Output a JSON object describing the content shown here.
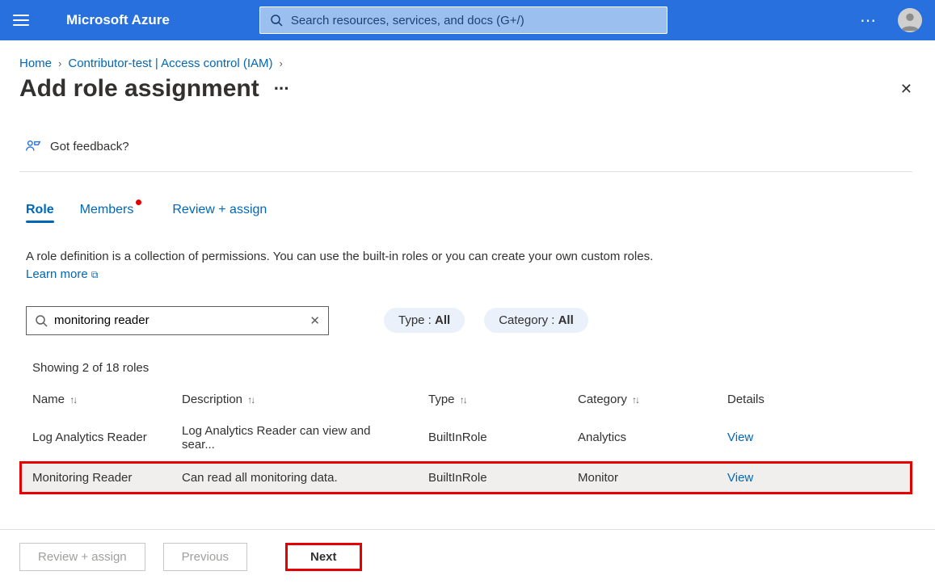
{
  "header": {
    "brand": "Microsoft Azure",
    "searchPlaceholder": "Search resources, services, and docs (G+/)",
    "moreLabel": "⋯"
  },
  "breadcrumb": {
    "home": "Home",
    "path": "Contributor-test | Access control (IAM)"
  },
  "page": {
    "title": "Add role assignment",
    "titleMore": "···",
    "close": "✕"
  },
  "feedback": {
    "label": "Got feedback?"
  },
  "tabs": {
    "role": "Role",
    "members": "Members",
    "review": "Review + assign"
  },
  "desc": {
    "text": "A role definition is a collection of permissions. You can use the built-in roles or you can create your own custom roles. ",
    "learnMore": "Learn more"
  },
  "filters": {
    "searchValue": "monitoring reader",
    "typeLabel": "Type : ",
    "typeValue": "All",
    "categoryLabel": "Category : ",
    "categoryValue": "All"
  },
  "results": {
    "countText": "Showing 2 of 18 roles",
    "columns": {
      "name": "Name",
      "desc": "Description",
      "type": "Type",
      "category": "Category",
      "details": "Details"
    },
    "viewLabel": "View",
    "rows": [
      {
        "name": "Log Analytics Reader",
        "desc": "Log Analytics Reader can view and sear...",
        "type": "BuiltInRole",
        "category": "Analytics",
        "highlight": false
      },
      {
        "name": "Monitoring Reader",
        "desc": "Can read all monitoring data.",
        "type": "BuiltInRole",
        "category": "Monitor",
        "highlight": true
      }
    ]
  },
  "footer": {
    "reviewAssign": "Review + assign",
    "previous": "Previous",
    "next": "Next"
  }
}
